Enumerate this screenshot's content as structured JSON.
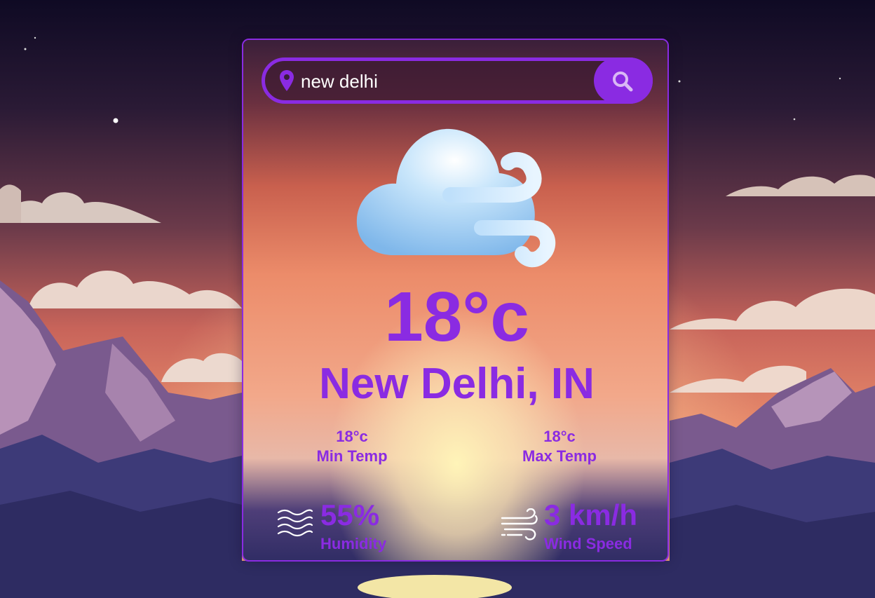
{
  "search": {
    "value": "new delhi"
  },
  "weather": {
    "temperature": "18°c",
    "city": "New Delhi, IN",
    "min_temp": "18°c",
    "min_label": "Min Temp",
    "max_temp": "18°c",
    "max_label": "Max Temp",
    "humidity": "55%",
    "humidity_label": "Humidity",
    "wind": "3 km/h",
    "wind_label": "Wind Speed",
    "condition_icon": "windy-cloud-icon"
  },
  "icons": {
    "location": "location-pin-icon",
    "search": "search-icon",
    "humidity": "humidity-waves-icon",
    "wind": "wind-icon"
  },
  "colors": {
    "accent": "#8a2be2",
    "text_on_input": "#ffffff"
  }
}
